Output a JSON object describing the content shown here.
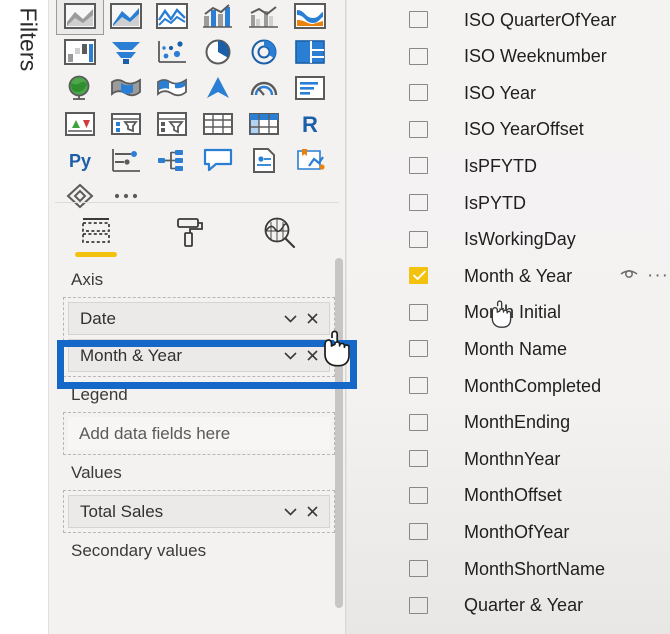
{
  "filters_pane": {
    "label": "Filters"
  },
  "visualizations": {
    "gallery": {
      "icons": [
        {
          "name": "stacked-area-chart-icon",
          "selected": true
        },
        {
          "name": "area-chart-icon",
          "selected": false
        },
        {
          "name": "line-chart-icon",
          "selected": false
        },
        {
          "name": "line-and-stacked-column-chart-icon",
          "selected": false
        },
        {
          "name": "line-and-clustered-column-chart-icon",
          "selected": false
        },
        {
          "name": "ribbon-chart-icon",
          "selected": false
        },
        {
          "name": "waterfall-chart-icon",
          "selected": false
        },
        {
          "name": "funnel-chart-icon",
          "selected": false
        },
        {
          "name": "scatter-chart-icon",
          "selected": false
        },
        {
          "name": "pie-chart-icon",
          "selected": false
        },
        {
          "name": "donut-chart-icon",
          "selected": false
        },
        {
          "name": "treemap-icon",
          "selected": false
        },
        {
          "name": "map-icon",
          "selected": false
        },
        {
          "name": "filled-map-icon",
          "selected": false
        },
        {
          "name": "shape-map-icon",
          "selected": false
        },
        {
          "name": "arcgis-map-icon",
          "selected": false
        },
        {
          "name": "gauge-icon",
          "selected": false
        },
        {
          "name": "card-icon",
          "selected": false
        },
        {
          "name": "multi-row-card-icon",
          "selected": false
        },
        {
          "name": "kpi-icon",
          "selected": false
        },
        {
          "name": "slicer-icon",
          "selected": false
        },
        {
          "name": "table-icon",
          "selected": false
        },
        {
          "name": "matrix-icon",
          "selected": false
        },
        {
          "name": "r-script-visual-icon",
          "selected": false
        },
        {
          "name": "python-visual-icon",
          "selected": false
        },
        {
          "name": "key-influencers-icon",
          "selected": false
        },
        {
          "name": "decomposition-tree-icon",
          "selected": false
        },
        {
          "name": "qna-visual-icon",
          "selected": false
        },
        {
          "name": "smart-narrative-icon",
          "selected": false
        },
        {
          "name": "paginated-report-icon",
          "selected": false
        },
        {
          "name": "power-apps-icon",
          "selected": false
        },
        {
          "name": "more-options-icon",
          "selected": false
        }
      ]
    },
    "tabs": [
      {
        "name": "build-visual-tab",
        "label": "Build visual",
        "active": true
      },
      {
        "name": "format-visual-tab",
        "label": "Format visual",
        "active": false
      },
      {
        "name": "analytics-tab",
        "label": "Analytics",
        "active": false
      }
    ],
    "wells": [
      {
        "name": "axis-well",
        "label": "Axis",
        "chips": [
          {
            "text": "Date",
            "has_dropdown": true,
            "has_remove": true
          },
          {
            "text": "Month & Year",
            "has_dropdown": true,
            "has_remove": true
          }
        ],
        "placeholder": null
      },
      {
        "name": "legend-well",
        "label": "Legend",
        "chips": [],
        "placeholder": "Add data fields here"
      },
      {
        "name": "values-well",
        "label": "Values",
        "chips": [
          {
            "text": "Total Sales",
            "has_dropdown": true,
            "has_remove": true
          }
        ],
        "placeholder": null
      },
      {
        "name": "secondary-values-well",
        "label": "Secondary values",
        "chips": [],
        "placeholder": null
      }
    ]
  },
  "fields_pane": {
    "items": [
      {
        "label": "ISO QuarterOfYear",
        "checked": false,
        "has_actions": false
      },
      {
        "label": "ISO Weeknumber",
        "checked": false,
        "has_actions": false
      },
      {
        "label": "ISO Year",
        "checked": false,
        "has_actions": false
      },
      {
        "label": "ISO YearOffset",
        "checked": false,
        "has_actions": false
      },
      {
        "label": "IsPFYTD",
        "checked": false,
        "has_actions": false
      },
      {
        "label": "IsPYTD",
        "checked": false,
        "has_actions": false
      },
      {
        "label": "IsWorkingDay",
        "checked": false,
        "has_actions": false
      },
      {
        "label": "Month & Year",
        "checked": true,
        "has_actions": true
      },
      {
        "label": "Month Initial",
        "checked": false,
        "has_actions": false
      },
      {
        "label": "Month Name",
        "checked": false,
        "has_actions": false
      },
      {
        "label": "MonthCompleted",
        "checked": false,
        "has_actions": false
      },
      {
        "label": "MonthEnding",
        "checked": false,
        "has_actions": false
      },
      {
        "label": "MonthnYear",
        "checked": false,
        "has_actions": false
      },
      {
        "label": "MonthOffset",
        "checked": false,
        "has_actions": false
      },
      {
        "label": "MonthOfYear",
        "checked": false,
        "has_actions": false
      },
      {
        "label": "MonthShortName",
        "checked": false,
        "has_actions": false
      },
      {
        "label": "Quarter & Year",
        "checked": false,
        "has_actions": false
      }
    ],
    "row_actions": {
      "hide_icon": "eye-icon",
      "more_icon": "more-options-icon",
      "more_label": "···"
    }
  },
  "annotation": {
    "highlight_color": "#1668c8",
    "highlight_target": "Month & Year"
  },
  "colors": {
    "accent_blue": "#1668c8",
    "checkbox_yellow": "#f2c20c",
    "panel_bg": "#f3f2f1"
  }
}
